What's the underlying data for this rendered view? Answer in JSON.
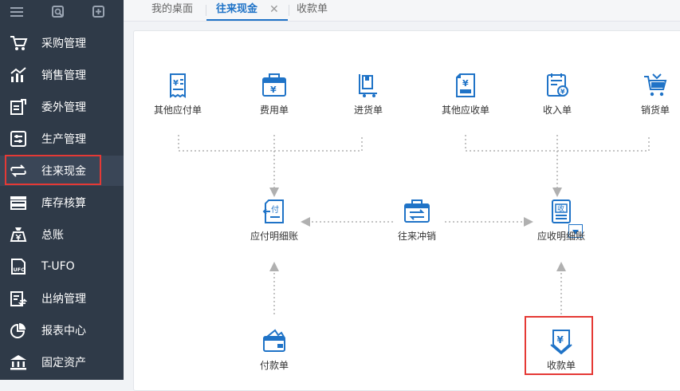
{
  "sidebar": {
    "items": [
      {
        "label": "采购管理",
        "icon": "purchase-cart-icon"
      },
      {
        "label": "销售管理",
        "icon": "sales-chart-icon"
      },
      {
        "label": "委外管理",
        "icon": "outsource-icon"
      },
      {
        "label": "生产管理",
        "icon": "production-sliders-icon"
      },
      {
        "label": "往来现金",
        "icon": "exchange-arrows-icon"
      },
      {
        "label": "库存核算",
        "icon": "inventory-icon"
      },
      {
        "label": "总账",
        "icon": "ledger-money-bag-icon"
      },
      {
        "label": "T-UFO",
        "icon": "ufo-report-icon"
      },
      {
        "label": "出纳管理",
        "icon": "cashier-icon"
      },
      {
        "label": "报表中心",
        "icon": "report-pie-icon"
      },
      {
        "label": "固定资产",
        "icon": "fixed-asset-bank-icon"
      }
    ]
  },
  "tabs": [
    {
      "label": "我的桌面"
    },
    {
      "label": "往来现金"
    },
    {
      "label": "收款单"
    }
  ],
  "flow": {
    "top_row": [
      {
        "label": "其他应付单",
        "icon": "other-payable-icon"
      },
      {
        "label": "费用单",
        "icon": "expense-icon"
      },
      {
        "label": "进货单",
        "icon": "purchase-receipt-icon"
      },
      {
        "label": "其他应收单",
        "icon": "other-receivable-icon"
      },
      {
        "label": "收入单",
        "icon": "income-icon"
      },
      {
        "label": "销货单",
        "icon": "sales-order-cart-icon"
      }
    ],
    "payable_ledger": {
      "label": "应付明细账",
      "icon_text": "付"
    },
    "offset": {
      "label": "往来冲销"
    },
    "receivable_ledger": {
      "label": "应收明细账",
      "icon_text": "收"
    },
    "payment": {
      "label": "付款单"
    },
    "receipt": {
      "label": "收款单"
    }
  },
  "colors": {
    "accent": "#1f73c7",
    "sidebar_bg": "#2f3a48",
    "highlight": "#e53935",
    "connector": "#b0b0b0"
  }
}
